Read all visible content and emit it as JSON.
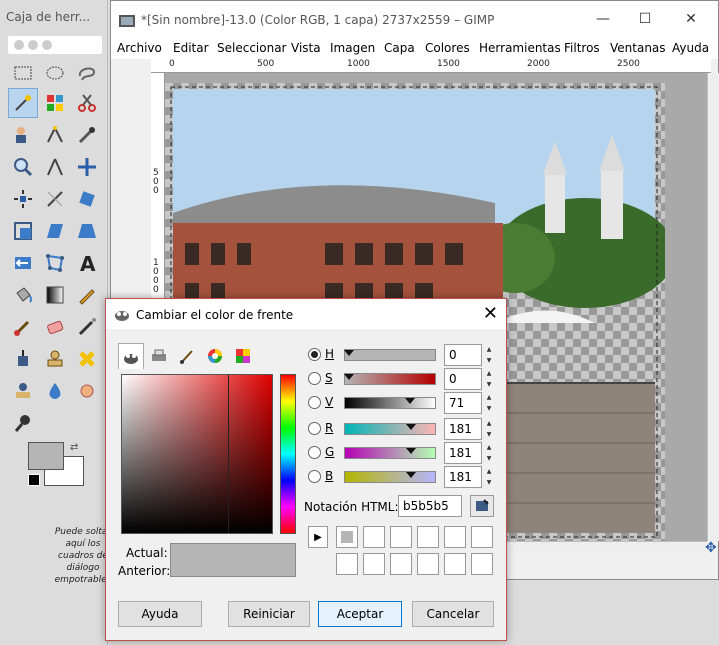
{
  "toolbox": {
    "title": "Caja de herr...",
    "drop_hint": "Puede soltar aquí los cuadros de diálogo empotrables",
    "fg_color": "#b5b5b5",
    "bg_color": "#ffffff"
  },
  "gimp_window": {
    "title": "*[Sin nombre]-13.0 (Color RGB, 1 capa) 2737x2559 – GIMP",
    "menu": [
      "Archivo",
      "Editar",
      "Seleccionar",
      "Vista",
      "Imagen",
      "Capa",
      "Colores",
      "Herramientas",
      "Filtros",
      "Ventanas",
      "Ayuda"
    ],
    "ruler_top": [
      "0",
      "500",
      "1000",
      "1500",
      "2000",
      "2500"
    ],
    "ruler_left": [
      "5\n0\n0",
      "1\n0\n0\n0"
    ]
  },
  "color_dialog": {
    "title": "Cambiar el color de frente",
    "channels": [
      {
        "letter": "H",
        "value": "0",
        "selected": true
      },
      {
        "letter": "S",
        "value": "0",
        "selected": false
      },
      {
        "letter": "V",
        "value": "71",
        "selected": false
      },
      {
        "letter": "R",
        "value": "181",
        "selected": false
      },
      {
        "letter": "G",
        "value": "181",
        "selected": false
      },
      {
        "letter": "B",
        "value": "181",
        "selected": false
      }
    ],
    "html_label": "Notación HTML:",
    "html_value": "b5b5b5",
    "current_label": "Actual:",
    "previous_label": "Anterior:",
    "current_color": "#b5b5b5",
    "buttons": {
      "help": "Ayuda",
      "reset": "Reiniciar",
      "ok": "Aceptar",
      "cancel": "Cancelar"
    }
  }
}
